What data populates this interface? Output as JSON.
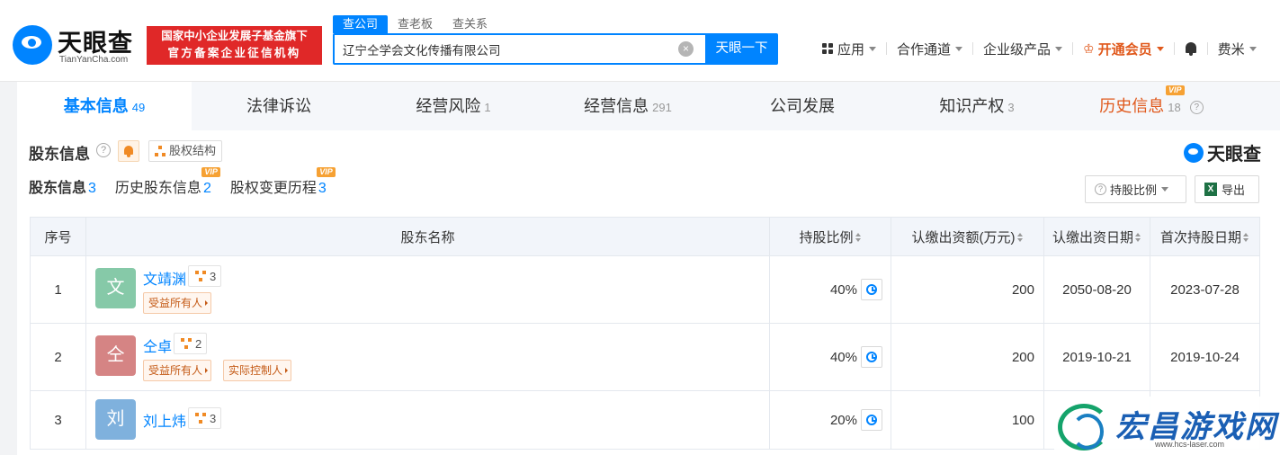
{
  "header": {
    "logo": {
      "name": "天眼查",
      "domain": "TianYanCha.com"
    },
    "gov_badge": {
      "line1": "国家中小企业发展子基金旗下",
      "line2": "官方备案企业征信机构"
    },
    "search_tabs": [
      "查公司",
      "查老板",
      "查关系"
    ],
    "search_value": "辽宁仝学会文化传播有限公司",
    "clear_glyph": "×",
    "search_button": "天眼一下",
    "nav": {
      "apps": "应用",
      "cooperation": "合作通道",
      "enterprise": "企业级产品",
      "vip": "开通会员",
      "vip_icon": "♔",
      "user": "费米"
    }
  },
  "tabs": [
    {
      "label": "基本信息",
      "count": "49"
    },
    {
      "label": "法律诉讼",
      "count": ""
    },
    {
      "label": "经营风险",
      "count": "1"
    },
    {
      "label": "经营信息",
      "count": "291"
    },
    {
      "label": "公司发展",
      "count": ""
    },
    {
      "label": "知识产权",
      "count": "3"
    },
    {
      "label": "历史信息",
      "count": "18",
      "vip": "VIP",
      "help": "?"
    }
  ],
  "section": {
    "title": "股东信息",
    "help": "?",
    "equity_button": "股权结构",
    "brand": "天眼查",
    "subtabs": [
      {
        "label": "股东信息",
        "count": "3"
      },
      {
        "label": "历史股东信息",
        "count": "2",
        "vip": "VIP"
      },
      {
        "label": "股权变更历程",
        "count": "3",
        "vip": "VIP"
      }
    ],
    "ratio_button": "持股比例",
    "ratio_help": "?",
    "export_button": "导出",
    "excel_glyph": "X"
  },
  "table": {
    "headers": {
      "num": "序号",
      "name": "股东名称",
      "ratio": "持股比例",
      "amount": "认缴出资额(万元)",
      "date1": "认缴出资日期",
      "date2": "首次持股日期"
    },
    "rows": [
      {
        "num": "1",
        "avatar": "文",
        "avatar_color": "#86c9a8",
        "name": "文靖渊",
        "relations": "3",
        "tags": [
          "受益所有人"
        ],
        "ratio": "40%",
        "amount": "200",
        "date1": "2050-08-20",
        "date2": "2023-07-28"
      },
      {
        "num": "2",
        "avatar": "仝",
        "avatar_color": "#d58484",
        "name": "仝卓",
        "relations": "2",
        "tags": [
          "受益所有人",
          "实际控制人"
        ],
        "ratio": "40%",
        "amount": "200",
        "date1": "2019-10-21",
        "date2": "2019-10-24"
      },
      {
        "num": "3",
        "avatar": "刘",
        "avatar_color": "#7fb1dd",
        "name": "刘上炜",
        "relations": "3",
        "tags": [],
        "ratio": "20%",
        "amount": "100",
        "date1": "",
        "date2": ""
      }
    ]
  },
  "site_watermark": {
    "title": "宏昌游戏网",
    "url": "www.hcs-laser.com"
  },
  "colors": {
    "accent": "#0084ff",
    "vip": "#e0581b",
    "badge_red": "#e02828"
  }
}
